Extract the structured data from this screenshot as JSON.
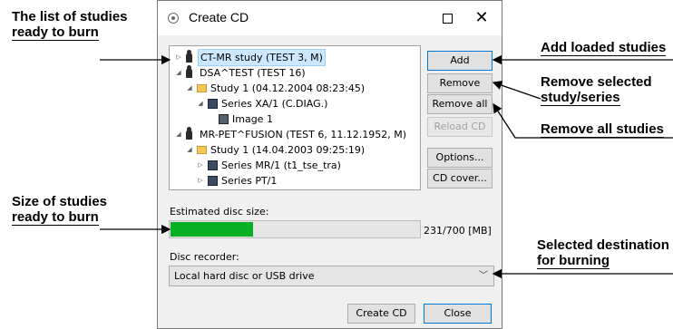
{
  "callouts": {
    "studies_list_1": "The list of studies",
    "studies_list_2": "ready to burn",
    "size_1": "Size of studies",
    "size_2": "ready to burn",
    "add_loaded": "Add loaded studies",
    "remove_sel_1": "Remove selected",
    "remove_sel_2": "study/series",
    "remove_all": "Remove all studies",
    "dest_1": "Selected destination",
    "dest_2": "for burning"
  },
  "window": {
    "title": "Create CD",
    "maximize_icon": "maximize-icon",
    "close_glyph": "✕"
  },
  "tree": [
    {
      "label": "CT-MR study (TEST 3, M)",
      "icon": "person-icon",
      "expander": "▷",
      "selected": true
    },
    {
      "label": "DSA^TEST (TEST 16)",
      "icon": "person-icon",
      "expander": "◢"
    },
    {
      "label": "Study 1 (04.12.2004 08:23:45)",
      "icon": "folder-icon",
      "expander": "◢"
    },
    {
      "label": "Series XA/1 (C.DIAG.)",
      "icon": "series-icon",
      "expander": "◢"
    },
    {
      "label": "Image 1",
      "icon": "image-icon",
      "expander": ""
    },
    {
      "label": "MR-PET^FUSION (TEST 6, 11.12.1952, M)",
      "icon": "person-icon",
      "expander": "◢"
    },
    {
      "label": "Study 1 (14.04.2003 09:25:19)",
      "icon": "folder-icon",
      "expander": "◢"
    },
    {
      "label": "Series MR/1 (t1_tse_tra)",
      "icon": "series-icon",
      "expander": "▷"
    },
    {
      "label": "Series PT/1",
      "icon": "series-icon",
      "expander": "▷"
    }
  ],
  "buttons": {
    "add": "Add",
    "remove": "Remove",
    "remove_all": "Remove all",
    "reload_cd": "Reload CD",
    "options": "Options...",
    "cd_cover": "CD cover...",
    "create_cd": "Create CD",
    "close": "Close"
  },
  "disc": {
    "size_label": "Estimated disc size:",
    "used_mb": 231,
    "capacity_mb": 700,
    "size_text": "231/700 [MB]"
  },
  "recorder": {
    "label": "Disc recorder:",
    "selected": "Local hard disc or USB drive"
  },
  "colors": {
    "progress_fill": "#06b025",
    "selection": "#cce8ff",
    "default_button_border": "#0078d7"
  }
}
